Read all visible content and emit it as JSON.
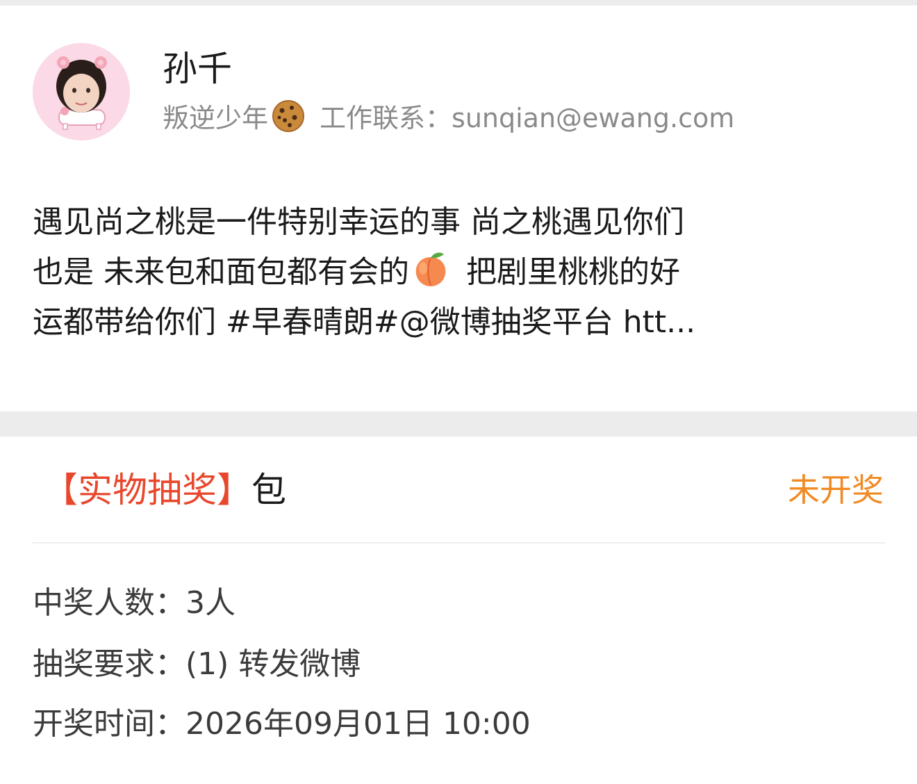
{
  "post": {
    "username": "孙千",
    "bio_text": "叛逆少年",
    "bio_icon": "cookie-emoji",
    "contact_label": "工作联系：",
    "contact_email": "sunqian@ewang.com",
    "content_lines": [
      "遇见尚之桃是一件特别幸运的事 尚之桃遇见你们",
      "也是 未来包和面包都有会的",
      "把剧里桃桃的好",
      "运都带给你们 #早春晴朗#@微博抽奖平台  htt..."
    ],
    "inline_emoji": "peach-emoji"
  },
  "lottery": {
    "type_label": "【实物抽奖】",
    "prize": "包",
    "status": "未开奖",
    "winners_label": "中奖人数：",
    "winners_value": "3人",
    "requirement_label": "抽奖要求：",
    "requirement_value": "(1) 转发微博",
    "draw_time_label": "开奖时间：",
    "draw_time_value": "2026年09月01日 10:00"
  },
  "colors": {
    "accent_red": "#e8472c",
    "status_orange": "#f08a24",
    "secondary_gray": "#8a8a8a",
    "band_gray": "#ececec"
  }
}
